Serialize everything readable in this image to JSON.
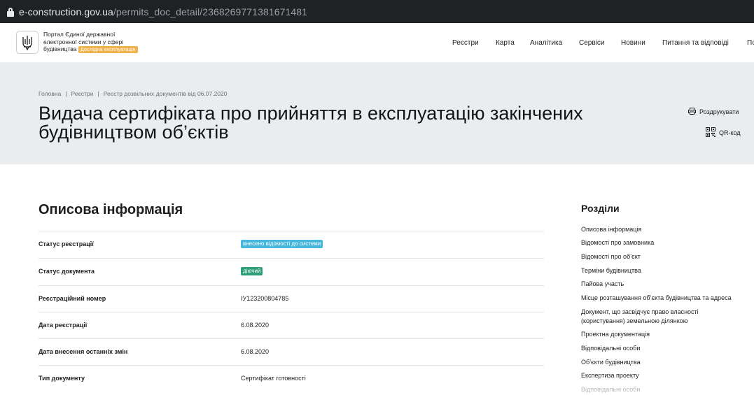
{
  "browser": {
    "url_host": "e-construction.gov.ua",
    "url_path": "/permits_doc_detail/2368269771381671481"
  },
  "header": {
    "logo_icon": "trident-icon",
    "portal_title_line1": "Портал Єдиної державної",
    "portal_title_line2": "електронної системи у сфері",
    "portal_title_line3": "будівництва",
    "beta_badge": "Дослідна експлуатація",
    "beta_color": "#f0b14a",
    "nav": [
      {
        "label": "Реєстри"
      },
      {
        "label": "Карта"
      },
      {
        "label": "Аналітика"
      },
      {
        "label": "Сервіси"
      },
      {
        "label": "Новини"
      },
      {
        "label": "Питання та відповіді"
      },
      {
        "label": "По"
      }
    ]
  },
  "hero": {
    "breadcrumb": [
      "Головна",
      "Реєстри",
      "Реєстр дозвільних документів від 06.07.2020"
    ],
    "title": "Видача сертифіката про прийняття в експлуатацію закінчених будівництвом об’єктів",
    "actions": {
      "print_label": "Роздрукувати",
      "print_icon": "printer-icon",
      "qr_label": "QR-код",
      "qr_icon": "qr-code-icon"
    }
  },
  "main": {
    "section_title": "Описова інформація",
    "rows": [
      {
        "key": "Статус реєстрації",
        "value": "внесено відомості до системи",
        "badge_color": "#46b8de"
      },
      {
        "key": "Статус документа",
        "value": "діючий",
        "badge_color": "#2f9e7a"
      },
      {
        "key": "Реєстраційний номер",
        "value": "ІУ123200804785"
      },
      {
        "key": "Дата реєстрації",
        "value": "6.08.2020"
      },
      {
        "key": "Дата внесення останніх змін",
        "value": "6.08.2020"
      },
      {
        "key": "Тип документу",
        "value": "Сертифікат готовності"
      }
    ]
  },
  "sidebar": {
    "title": "Розділи",
    "items": [
      {
        "label": "Описова інформація"
      },
      {
        "label": "Відомості про замовника"
      },
      {
        "label": "Відомості про об’єкт"
      },
      {
        "label": "Терміни будівництва"
      },
      {
        "label": "Пайова участь"
      },
      {
        "label": "Місце розташування об’єкта будівництва та адреса"
      },
      {
        "label_line1": "Документ, що засвідчує право власності",
        "label_line2": "(користування) земельною ділянкою"
      },
      {
        "label": "Проектна документація"
      },
      {
        "label": "Відповідальні особи"
      },
      {
        "label": "Об’єкти будівництва"
      },
      {
        "label": "Експертиза проекту"
      },
      {
        "label": "Відповідальні особи"
      }
    ]
  }
}
